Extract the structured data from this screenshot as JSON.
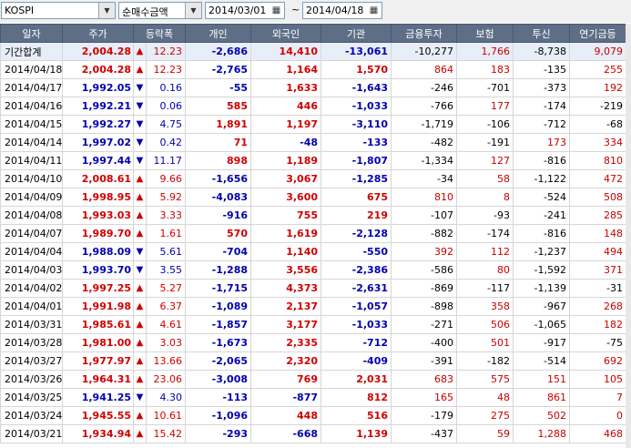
{
  "toolbar": {
    "market": "KOSPI",
    "metric": "순매수금액",
    "date_from": "2014/03/01",
    "separator": "~",
    "date_to": "2014/04/18"
  },
  "columns": [
    "일자",
    "주가",
    "등락폭",
    "개인",
    "외국인",
    "기관",
    "금융투자",
    "보험",
    "투신",
    "연기금등"
  ],
  "rows": [
    {
      "date": "기간합계",
      "price": "2,004.28",
      "dir": "up",
      "chg": "12.23",
      "ind": "-2,686",
      "frn": "14,410",
      "inst": "-13,061",
      "fin": "-10,277",
      "ins": "1,766",
      "trust": "-8,738",
      "pen": "9,079",
      "total": true
    },
    {
      "date": "2014/04/18",
      "price": "2,004.28",
      "dir": "up",
      "chg": "12.23",
      "ind": "-2,765",
      "frn": "1,164",
      "inst": "1,570",
      "fin": "864",
      "ins": "183",
      "trust": "-135",
      "pen": "255"
    },
    {
      "date": "2014/04/17",
      "price": "1,992.05",
      "dir": "down",
      "chg": "0.16",
      "ind": "-55",
      "frn": "1,633",
      "inst": "-1,643",
      "fin": "-246",
      "ins": "-701",
      "trust": "-373",
      "pen": "192"
    },
    {
      "date": "2014/04/16",
      "price": "1,992.21",
      "dir": "down",
      "chg": "0.06",
      "ind": "585",
      "frn": "446",
      "inst": "-1,033",
      "fin": "-766",
      "ins": "177",
      "trust": "-174",
      "pen": "-219"
    },
    {
      "date": "2014/04/15",
      "price": "1,992.27",
      "dir": "down",
      "chg": "4.75",
      "ind": "1,891",
      "frn": "1,197",
      "inst": "-3,110",
      "fin": "-1,719",
      "ins": "-106",
      "trust": "-712",
      "pen": "-68"
    },
    {
      "date": "2014/04/14",
      "price": "1,997.02",
      "dir": "down",
      "chg": "0.42",
      "ind": "71",
      "frn": "-48",
      "inst": "-133",
      "fin": "-482",
      "ins": "-191",
      "trust": "173",
      "pen": "334"
    },
    {
      "date": "2014/04/11",
      "price": "1,997.44",
      "dir": "down",
      "chg": "11.17",
      "ind": "898",
      "frn": "1,189",
      "inst": "-1,807",
      "fin": "-1,334",
      "ins": "127",
      "trust": "-816",
      "pen": "810"
    },
    {
      "date": "2014/04/10",
      "price": "2,008.61",
      "dir": "up",
      "chg": "9.66",
      "ind": "-1,656",
      "frn": "3,067",
      "inst": "-1,285",
      "fin": "-34",
      "ins": "58",
      "trust": "-1,122",
      "pen": "472"
    },
    {
      "date": "2014/04/09",
      "price": "1,998.95",
      "dir": "up",
      "chg": "5.92",
      "ind": "-4,083",
      "frn": "3,600",
      "inst": "675",
      "fin": "810",
      "ins": "8",
      "trust": "-524",
      "pen": "508"
    },
    {
      "date": "2014/04/08",
      "price": "1,993.03",
      "dir": "up",
      "chg": "3.33",
      "ind": "-916",
      "frn": "755",
      "inst": "219",
      "fin": "-107",
      "ins": "-93",
      "trust": "-241",
      "pen": "285"
    },
    {
      "date": "2014/04/07",
      "price": "1,989.70",
      "dir": "up",
      "chg": "1.61",
      "ind": "570",
      "frn": "1,619",
      "inst": "-2,128",
      "fin": "-882",
      "ins": "-174",
      "trust": "-816",
      "pen": "148"
    },
    {
      "date": "2014/04/04",
      "price": "1,988.09",
      "dir": "down",
      "chg": "5.61",
      "ind": "-704",
      "frn": "1,140",
      "inst": "-550",
      "fin": "392",
      "ins": "112",
      "trust": "-1,237",
      "pen": "494"
    },
    {
      "date": "2014/04/03",
      "price": "1,993.70",
      "dir": "down",
      "chg": "3.55",
      "ind": "-1,288",
      "frn": "3,556",
      "inst": "-2,386",
      "fin": "-586",
      "ins": "80",
      "trust": "-1,592",
      "pen": "371"
    },
    {
      "date": "2014/04/02",
      "price": "1,997.25",
      "dir": "up",
      "chg": "5.27",
      "ind": "-1,715",
      "frn": "4,373",
      "inst": "-2,631",
      "fin": "-869",
      "ins": "-117",
      "trust": "-1,139",
      "pen": "-31"
    },
    {
      "date": "2014/04/01",
      "price": "1,991.98",
      "dir": "up",
      "chg": "6.37",
      "ind": "-1,089",
      "frn": "2,137",
      "inst": "-1,057",
      "fin": "-898",
      "ins": "358",
      "trust": "-967",
      "pen": "268"
    },
    {
      "date": "2014/03/31",
      "price": "1,985.61",
      "dir": "up",
      "chg": "4.61",
      "ind": "-1,857",
      "frn": "3,177",
      "inst": "-1,033",
      "fin": "-271",
      "ins": "506",
      "trust": "-1,065",
      "pen": "182"
    },
    {
      "date": "2014/03/28",
      "price": "1,981.00",
      "dir": "up",
      "chg": "3.03",
      "ind": "-1,673",
      "frn": "2,335",
      "inst": "-712",
      "fin": "-400",
      "ins": "501",
      "trust": "-917",
      "pen": "-75"
    },
    {
      "date": "2014/03/27",
      "price": "1,977.97",
      "dir": "up",
      "chg": "13.66",
      "ind": "-2,065",
      "frn": "2,320",
      "inst": "-409",
      "fin": "-391",
      "ins": "-182",
      "trust": "-514",
      "pen": "692"
    },
    {
      "date": "2014/03/26",
      "price": "1,964.31",
      "dir": "up",
      "chg": "23.06",
      "ind": "-3,008",
      "frn": "769",
      "inst": "2,031",
      "fin": "683",
      "ins": "575",
      "trust": "151",
      "pen": "105"
    },
    {
      "date": "2014/03/25",
      "price": "1,941.25",
      "dir": "down",
      "chg": "4.30",
      "ind": "-113",
      "frn": "-877",
      "inst": "812",
      "fin": "165",
      "ins": "48",
      "trust": "861",
      "pen": "7"
    },
    {
      "date": "2014/03/24",
      "price": "1,945.55",
      "dir": "up",
      "chg": "10.61",
      "ind": "-1,096",
      "frn": "448",
      "inst": "516",
      "fin": "-179",
      "ins": "275",
      "trust": "502",
      "pen": "0"
    },
    {
      "date": "2014/03/21",
      "price": "1,934.94",
      "dir": "up",
      "chg": "15.42",
      "ind": "-293",
      "frn": "-668",
      "inst": "1,139",
      "fin": "-437",
      "ins": "59",
      "trust": "1,288",
      "pen": "468"
    }
  ],
  "icons": {
    "up": "▲",
    "down": "▼",
    "dropdown": "▼",
    "calendar": "▦"
  },
  "colors": {
    "header_bg": "#5e6e86",
    "up": "#d00000",
    "down": "#0000b0"
  }
}
